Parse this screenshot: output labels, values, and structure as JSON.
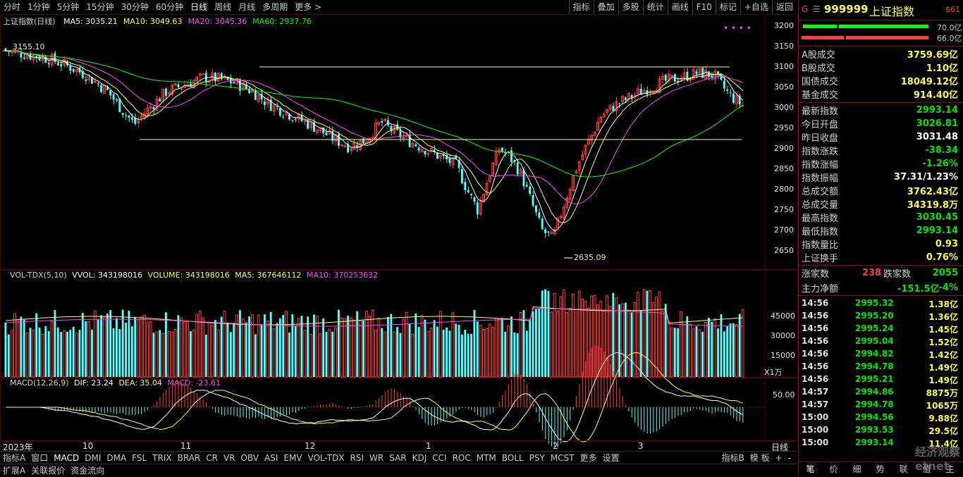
{
  "toolbar": {
    "periods": [
      "分时",
      "1分钟",
      "5分钟",
      "15分钟",
      "30分钟",
      "60分钟",
      "日线",
      "周线",
      "月线",
      "多周期",
      "更多 >"
    ],
    "active_period": "日线",
    "right": [
      "指标",
      "叠加",
      "多股",
      "统计",
      "画线",
      "F10",
      "标记",
      "+自选",
      "返回"
    ]
  },
  "main": {
    "title": "上证指数(日线)",
    "ma": [
      {
        "label": "MA5: 3035.21",
        "color": "#ffffff"
      },
      {
        "label": "MA10: 3049.63",
        "color": "#ffff54"
      },
      {
        "label": "MA20: 3045.36",
        "color": "#ff44ff"
      },
      {
        "label": "MA60: 2937.76",
        "color": "#00ff00"
      }
    ],
    "yticks": [
      "3200",
      "3150",
      "3100",
      "3050",
      "3000",
      "2950",
      "2900",
      "2850",
      "2800",
      "2750",
      "2700",
      "2650"
    ],
    "high_label": "3155.10",
    "low_label": "2635.09"
  },
  "vol": {
    "title": "VOL-TDX(5,10)",
    "vvol": "VVOL: 343198016",
    "volume": "VOLUME: 343198016",
    "ma5": "MA5: 367646112",
    "ma10": "MA10: 370253632",
    "yticks": [
      "45000",
      "30000",
      "15000"
    ],
    "unit": "X1万"
  },
  "macd": {
    "title": "MACD(12,26,9)",
    "dif": "DIF: 23.24",
    "dea": "DEA: 35.04",
    "macd": "MACD: -23.61",
    "ytick": "50.00"
  },
  "xaxis": {
    "labels": [
      "2023年",
      "10",
      "11",
      "12",
      "1",
      "2",
      "3"
    ],
    "corner": "日线"
  },
  "indicator_tabs": [
    "指标A",
    "窗口",
    "MACD",
    "DMI",
    "DMA",
    "FSL",
    "TRIX",
    "BRAR",
    "CR",
    "VR",
    "OBV",
    "ASI",
    "EMV",
    "VOL-TDX",
    "RSI",
    "WR",
    "SAR",
    "KDJ",
    "CCI",
    "ROC",
    "MTM",
    "BOLL",
    "PSY",
    "MCST",
    "更多",
    "设置"
  ],
  "indicator_right": [
    "指标B",
    "模 板",
    "+",
    "-"
  ],
  "status_tabs": [
    "扩展A",
    "关联报价",
    "资金流向"
  ],
  "quote": {
    "code": "999999",
    "name": "上证指数",
    "badge": "$61",
    "g": "G",
    "pct_top": "70.0亿",
    "pct_bottom": "66.0亿",
    "rows1": [
      {
        "k": "A股成交",
        "v": "3759.69亿",
        "c": "yellow"
      },
      {
        "k": "B股成交",
        "v": "1.10亿",
        "c": "yellow"
      },
      {
        "k": "国债成交",
        "v": "18049.12亿",
        "c": "yellow"
      },
      {
        "k": "基金成交",
        "v": "914.40亿",
        "c": "yellow"
      }
    ],
    "rows2": [
      {
        "k": "最新指数",
        "v": "2993.14",
        "c": "green"
      },
      {
        "k": "今日开盘",
        "v": "3026.81",
        "c": "green"
      },
      {
        "k": "昨日收盘",
        "v": "3031.48",
        "c": "white"
      },
      {
        "k": "指数涨跌",
        "v": "-38.34",
        "c": "green"
      },
      {
        "k": "指数涨幅",
        "v": "-1.26%",
        "c": "green"
      },
      {
        "k": "指数振幅",
        "v": "37.31/1.23%",
        "c": "white"
      },
      {
        "k": "总成交额",
        "v": "3762.43亿",
        "c": "yellow"
      },
      {
        "k": "总成交量",
        "v": "34319.8万",
        "c": "yellow"
      },
      {
        "k": "最高指数",
        "v": "3030.45",
        "c": "green"
      },
      {
        "k": "最低指数",
        "v": "2993.14",
        "c": "green"
      },
      {
        "k": "指数量比",
        "v": "0.93",
        "c": "yellow"
      },
      {
        "k": "上证换手",
        "v": "0.76%",
        "c": "yellow"
      }
    ],
    "up_label": "涨家数",
    "up_value": "238",
    "down_label": "跌家数",
    "down_value": "2055",
    "net_label": "主力净额",
    "net_value": "-151.5亿",
    "net_pct": "-4%",
    "ticks": [
      {
        "t": "14:56",
        "p": "2995.32",
        "v": "1.38亿"
      },
      {
        "t": "14:56",
        "p": "2995.20",
        "v": "1.36亿"
      },
      {
        "t": "14:56",
        "p": "2995.24",
        "v": "1.45亿"
      },
      {
        "t": "14:56",
        "p": "2995.04",
        "v": "1.52亿"
      },
      {
        "t": "14:56",
        "p": "2994.82",
        "v": "1.42亿"
      },
      {
        "t": "14:56",
        "p": "2994.78",
        "v": "1.49亿"
      },
      {
        "t": "14:56",
        "p": "2995.21",
        "v": "1.49亿"
      },
      {
        "t": "14:57",
        "p": "2994.86",
        "v": "8875万"
      },
      {
        "t": "14:57",
        "p": "2994.78",
        "v": "1065万"
      },
      {
        "t": "15:00",
        "p": "2994.56",
        "v": "9.88亿"
      },
      {
        "t": "15:00",
        "p": "2993.53",
        "v": "29.5亿"
      },
      {
        "t": "15:00",
        "p": "2993.14",
        "v": "11.4亿"
      }
    ],
    "bottom_tabs": [
      "笔",
      "价",
      "细",
      "势",
      "联",
      "值",
      "主"
    ],
    "watermark": "经济观察 etnet"
  }
}
